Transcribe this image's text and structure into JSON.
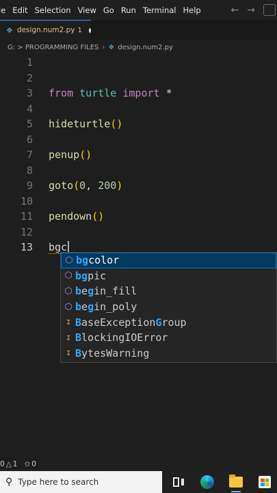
{
  "menubar": {
    "items": [
      "le",
      "Edit",
      "Selection",
      "View",
      "Go",
      "Run",
      "Terminal",
      "Help"
    ],
    "back_glyph": "←",
    "forward_glyph": "→"
  },
  "tab": {
    "label": "design.num2.py",
    "problems": "1"
  },
  "breadcrumb": {
    "folder": "G: > PROGRAMMING FILES",
    "file": "design.num2.py"
  },
  "editor": {
    "lines": [
      {
        "n": "1"
      },
      {
        "n": "2"
      },
      {
        "n": "3"
      },
      {
        "n": "4"
      },
      {
        "n": "5"
      },
      {
        "n": "6"
      },
      {
        "n": "7"
      },
      {
        "n": "8"
      },
      {
        "n": "9"
      },
      {
        "n": "10"
      },
      {
        "n": "11"
      },
      {
        "n": "12"
      },
      {
        "n": "13"
      }
    ],
    "code": {
      "l3_from": "from",
      "l3_module": "turtle",
      "l3_import": "import",
      "l3_star": "*",
      "l5_fn": "hideturtle",
      "l7_fn": "penup",
      "l9_fn": "goto",
      "l9_arg1": "0",
      "l9_arg2": "200",
      "l11_fn": "pendown",
      "l13_text": "bgc"
    }
  },
  "suggestions": [
    {
      "kind": "method",
      "match": "bg",
      "rest": "color"
    },
    {
      "kind": "method",
      "match": "bg",
      "rest": "pic"
    },
    {
      "kind": "method",
      "parts": [
        "b",
        "e",
        "g",
        "in_fill"
      ]
    },
    {
      "kind": "method",
      "parts": [
        "b",
        "e",
        "g",
        "in_poly"
      ]
    },
    {
      "kind": "class",
      "parts": [
        "B",
        "aseException",
        "G",
        "roup"
      ]
    },
    {
      "kind": "class",
      "parts": [
        "B",
        "locking",
        "IOError",
        ""
      ]
    },
    {
      "kind": "class",
      "parts": [
        "B",
        "ytesWarning",
        "",
        ""
      ]
    }
  ],
  "statusbar": {
    "errors": "0",
    "warnings": "1",
    "ports": "0"
  },
  "taskbar": {
    "search_placeholder": "Type here to search"
  }
}
